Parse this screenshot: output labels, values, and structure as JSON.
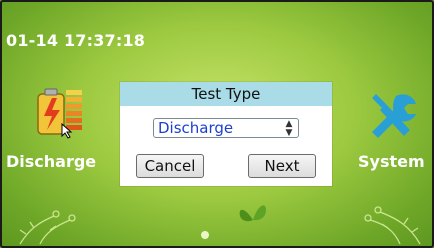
{
  "status": {
    "datetime": "01-14 17:37:18"
  },
  "apps": {
    "discharge": {
      "label": "Discharge",
      "icon": "battery-icon"
    },
    "system": {
      "label": "System",
      "icon": "tools-icon"
    }
  },
  "dialog": {
    "title": "Test Type",
    "select_value": "Discharge",
    "cancel_label": "Cancel",
    "next_label": "Next"
  },
  "colors": {
    "background": "#9cc940",
    "dialog_title_bg": "#a9dce6",
    "select_text": "#1d3fd0",
    "tools_icon": "#2a9fd6"
  }
}
